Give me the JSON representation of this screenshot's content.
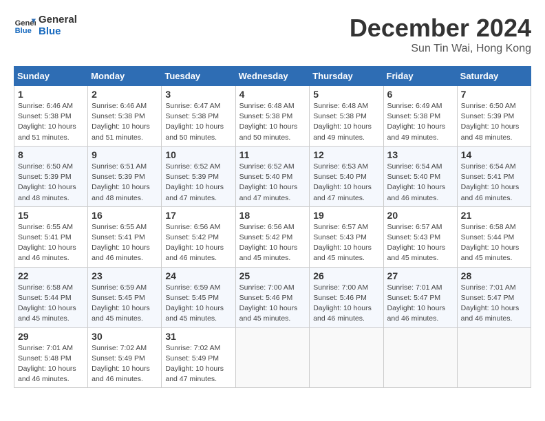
{
  "header": {
    "logo_line1": "General",
    "logo_line2": "Blue",
    "month": "December 2024",
    "location": "Sun Tin Wai, Hong Kong"
  },
  "weekdays": [
    "Sunday",
    "Monday",
    "Tuesday",
    "Wednesday",
    "Thursday",
    "Friday",
    "Saturday"
  ],
  "weeks": [
    [
      {
        "day": "1",
        "sunrise": "6:46 AM",
        "sunset": "5:38 PM",
        "daylight": "10 hours and 51 minutes."
      },
      {
        "day": "2",
        "sunrise": "6:46 AM",
        "sunset": "5:38 PM",
        "daylight": "10 hours and 51 minutes."
      },
      {
        "day": "3",
        "sunrise": "6:47 AM",
        "sunset": "5:38 PM",
        "daylight": "10 hours and 50 minutes."
      },
      {
        "day": "4",
        "sunrise": "6:48 AM",
        "sunset": "5:38 PM",
        "daylight": "10 hours and 50 minutes."
      },
      {
        "day": "5",
        "sunrise": "6:48 AM",
        "sunset": "5:38 PM",
        "daylight": "10 hours and 49 minutes."
      },
      {
        "day": "6",
        "sunrise": "6:49 AM",
        "sunset": "5:38 PM",
        "daylight": "10 hours and 49 minutes."
      },
      {
        "day": "7",
        "sunrise": "6:50 AM",
        "sunset": "5:39 PM",
        "daylight": "10 hours and 48 minutes."
      }
    ],
    [
      {
        "day": "8",
        "sunrise": "6:50 AM",
        "sunset": "5:39 PM",
        "daylight": "10 hours and 48 minutes."
      },
      {
        "day": "9",
        "sunrise": "6:51 AM",
        "sunset": "5:39 PM",
        "daylight": "10 hours and 48 minutes."
      },
      {
        "day": "10",
        "sunrise": "6:52 AM",
        "sunset": "5:39 PM",
        "daylight": "10 hours and 47 minutes."
      },
      {
        "day": "11",
        "sunrise": "6:52 AM",
        "sunset": "5:40 PM",
        "daylight": "10 hours and 47 minutes."
      },
      {
        "day": "12",
        "sunrise": "6:53 AM",
        "sunset": "5:40 PM",
        "daylight": "10 hours and 47 minutes."
      },
      {
        "day": "13",
        "sunrise": "6:54 AM",
        "sunset": "5:40 PM",
        "daylight": "10 hours and 46 minutes."
      },
      {
        "day": "14",
        "sunrise": "6:54 AM",
        "sunset": "5:41 PM",
        "daylight": "10 hours and 46 minutes."
      }
    ],
    [
      {
        "day": "15",
        "sunrise": "6:55 AM",
        "sunset": "5:41 PM",
        "daylight": "10 hours and 46 minutes."
      },
      {
        "day": "16",
        "sunrise": "6:55 AM",
        "sunset": "5:41 PM",
        "daylight": "10 hours and 46 minutes."
      },
      {
        "day": "17",
        "sunrise": "6:56 AM",
        "sunset": "5:42 PM",
        "daylight": "10 hours and 46 minutes."
      },
      {
        "day": "18",
        "sunrise": "6:56 AM",
        "sunset": "5:42 PM",
        "daylight": "10 hours and 45 minutes."
      },
      {
        "day": "19",
        "sunrise": "6:57 AM",
        "sunset": "5:43 PM",
        "daylight": "10 hours and 45 minutes."
      },
      {
        "day": "20",
        "sunrise": "6:57 AM",
        "sunset": "5:43 PM",
        "daylight": "10 hours and 45 minutes."
      },
      {
        "day": "21",
        "sunrise": "6:58 AM",
        "sunset": "5:44 PM",
        "daylight": "10 hours and 45 minutes."
      }
    ],
    [
      {
        "day": "22",
        "sunrise": "6:58 AM",
        "sunset": "5:44 PM",
        "daylight": "10 hours and 45 minutes."
      },
      {
        "day": "23",
        "sunrise": "6:59 AM",
        "sunset": "5:45 PM",
        "daylight": "10 hours and 45 minutes."
      },
      {
        "day": "24",
        "sunrise": "6:59 AM",
        "sunset": "5:45 PM",
        "daylight": "10 hours and 45 minutes."
      },
      {
        "day": "25",
        "sunrise": "7:00 AM",
        "sunset": "5:46 PM",
        "daylight": "10 hours and 45 minutes."
      },
      {
        "day": "26",
        "sunrise": "7:00 AM",
        "sunset": "5:46 PM",
        "daylight": "10 hours and 46 minutes."
      },
      {
        "day": "27",
        "sunrise": "7:01 AM",
        "sunset": "5:47 PM",
        "daylight": "10 hours and 46 minutes."
      },
      {
        "day": "28",
        "sunrise": "7:01 AM",
        "sunset": "5:47 PM",
        "daylight": "10 hours and 46 minutes."
      }
    ],
    [
      {
        "day": "29",
        "sunrise": "7:01 AM",
        "sunset": "5:48 PM",
        "daylight": "10 hours and 46 minutes."
      },
      {
        "day": "30",
        "sunrise": "7:02 AM",
        "sunset": "5:49 PM",
        "daylight": "10 hours and 46 minutes."
      },
      {
        "day": "31",
        "sunrise": "7:02 AM",
        "sunset": "5:49 PM",
        "daylight": "10 hours and 47 minutes."
      },
      null,
      null,
      null,
      null
    ]
  ],
  "labels": {
    "sunrise": "Sunrise:",
    "sunset": "Sunset:",
    "daylight": "Daylight:"
  }
}
